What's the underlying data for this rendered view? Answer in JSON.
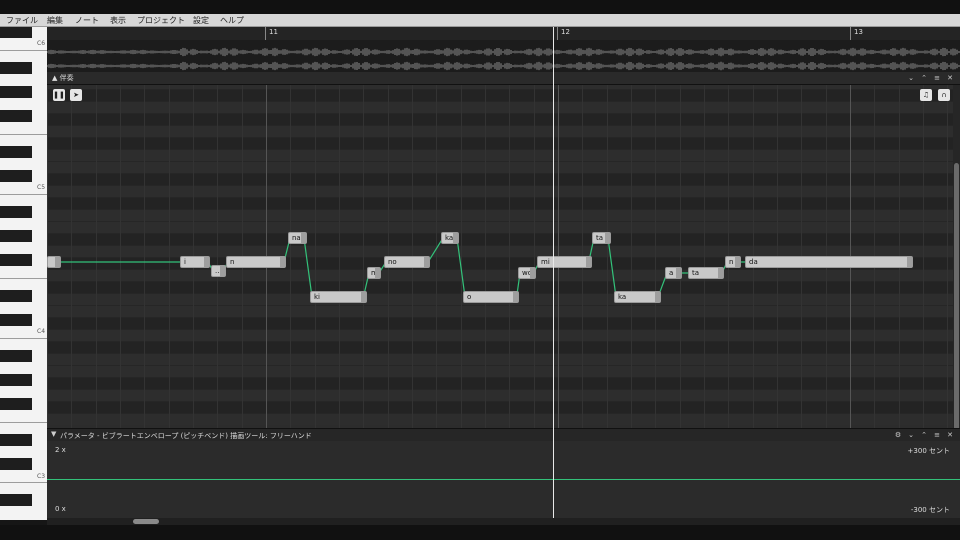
{
  "menu": [
    "ファイル",
    "編集",
    "ノート",
    "表示",
    "プロジェクト",
    "設定",
    "ヘルプ"
  ],
  "keyboard": {
    "labels": [
      "C6",
      "C5",
      "C4",
      "C3"
    ]
  },
  "ruler": {
    "bars": [
      "11",
      "12",
      "13"
    ]
  },
  "track": {
    "name": "伴奏"
  },
  "param_panel": {
    "title": "パラメータ - ビブラートエンベロープ (ピッチベンド) 描画ツール: フリーハンド",
    "left_top": "2 x",
    "left_bottom": "0 x",
    "right_top": "+300 セント",
    "right_bottom": "-300 セント"
  },
  "icons": {
    "collapse": "triangle-icon",
    "pause": "pause-icon",
    "select_tool": "arrow-cursor-icon",
    "note": "music-note-icon",
    "headphones": "headphones-icon"
  },
  "colors": {
    "pitch_line": "#33c27a",
    "note_fill": "#c9c9c9"
  },
  "notes": [
    {
      "lyric": ""
    },
    {
      "lyric": "i"
    },
    {
      "lyric": "..."
    },
    {
      "lyric": "n"
    },
    {
      "lyric": "na"
    },
    {
      "lyric": "ki"
    },
    {
      "lyric": "mi"
    },
    {
      "lyric": "no"
    },
    {
      "lyric": "ka"
    },
    {
      "lyric": "o"
    },
    {
      "lyric": "wo"
    },
    {
      "lyric": "mi"
    },
    {
      "lyric": "ta"
    },
    {
      "lyric": "ka"
    },
    {
      "lyric": "a"
    },
    {
      "lyric": "ta"
    },
    {
      "lyric": "n"
    },
    {
      "lyric": "da"
    }
  ]
}
